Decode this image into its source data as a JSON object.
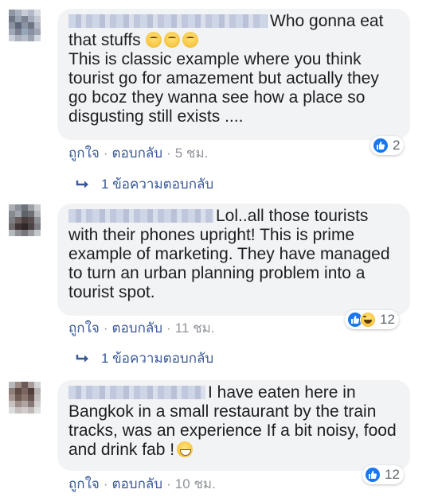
{
  "comments": [
    {
      "text": "Who gonna eat that stuffs",
      "text2": "This is classic example where you think tourist go for amazement but actually they go bcoz they wanna see how a place so disgusting still exists ....",
      "like_label": "ถูกใจ",
      "reply_label": "ตอบกลับ",
      "time": "5 ชม.",
      "reaction_count": "2",
      "replies_label": "1 ข้อความตอบกลับ"
    },
    {
      "text": "Lol..all those tourists with their phones upright! This is prime example of marketing. They have managed to turn an urban planning problem into a tourist spot.",
      "like_label": "ถูกใจ",
      "reply_label": "ตอบกลับ",
      "time": "11 ชม.",
      "reaction_count": "12",
      "replies_label": "1 ข้อความตอบกลับ"
    },
    {
      "text": "I have eaten here in Bangkok in a small restaurant by the train tracks, was an experience If a bit noisy, food and drink fab !",
      "like_label": "ถูกใจ",
      "reply_label": "ตอบกลับ",
      "time": "10 ชม.",
      "reaction_count": "12"
    }
  ],
  "separator": "·",
  "colors": {
    "bubble": "#f2f3f5",
    "link": "#385898",
    "like_blue": "#1877f2",
    "meta_gray": "#90949c"
  },
  "icons": [
    "like-icon",
    "haha-icon",
    "reply-arrow-icon",
    "thinking-emoji-icon",
    "grin-emoji-icon"
  ]
}
